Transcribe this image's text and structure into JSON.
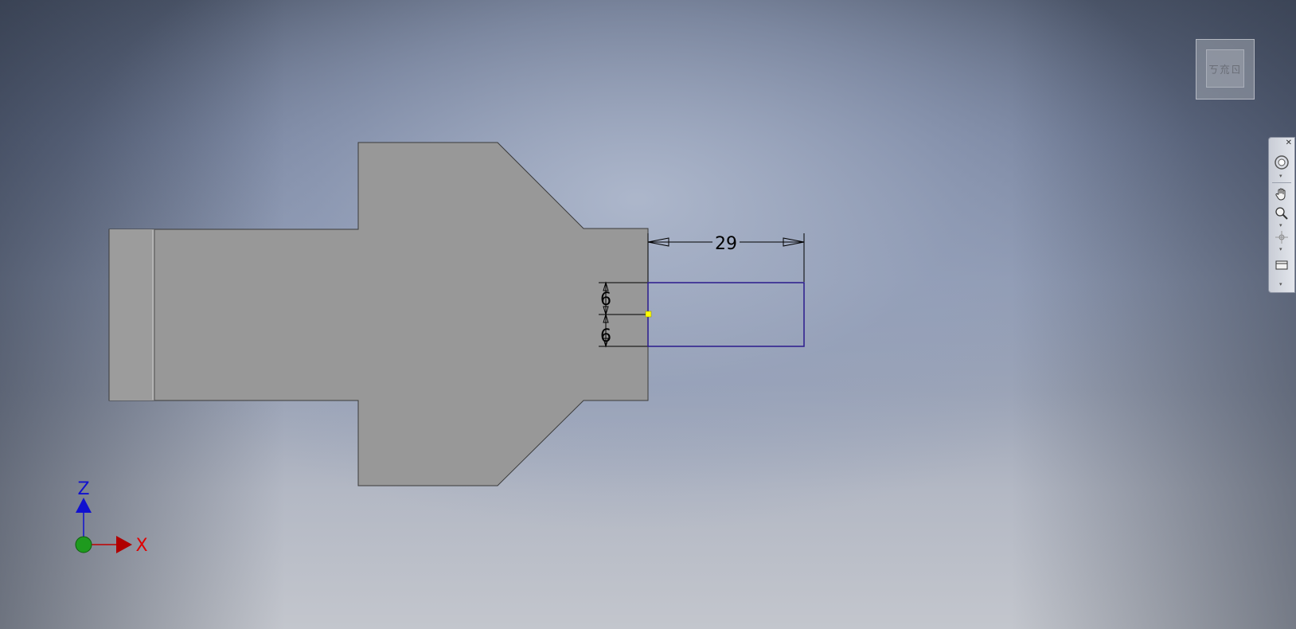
{
  "dimensions": {
    "horizontal": "29",
    "vertical_upper": "6",
    "vertical_lower": "6"
  },
  "triad": {
    "z_label": "Z",
    "x_label": "X"
  },
  "viewcube": {
    "face_label": "ㄎ㐬ㄖ"
  },
  "navbar": {
    "close_glyph": "✕",
    "tools": [
      "steering-wheel-icon",
      "pan-icon",
      "zoom-icon",
      "orbit-icon",
      "look-at-icon"
    ]
  },
  "colors": {
    "part_face": "#999999",
    "part_edge": "#3a3a3a",
    "sketch_rectangle": "#2a1a8c",
    "constraint_point": "#ffff00",
    "z_axis": "#1010d0",
    "x_axis": "#c00000",
    "origin": "#1e9a1e"
  }
}
